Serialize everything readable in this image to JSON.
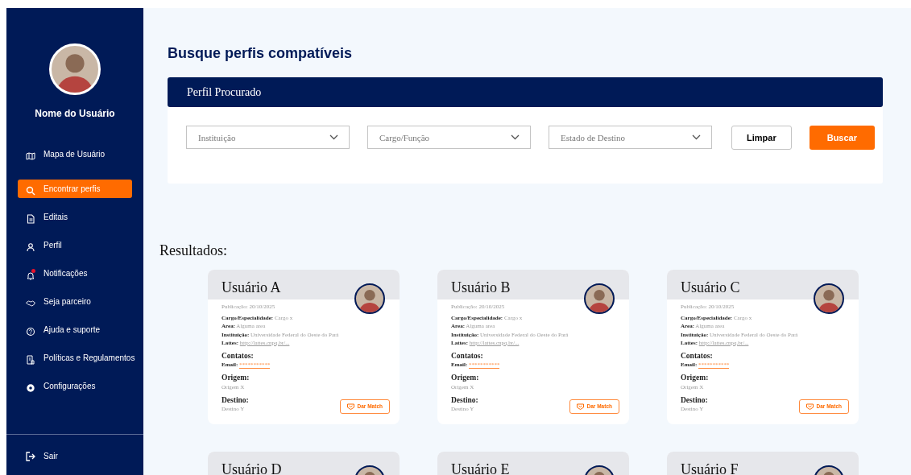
{
  "sidebar": {
    "user_name": "Nome do Usuário",
    "items": [
      {
        "label": "Mapa de Usuário",
        "selected": false,
        "alert": false
      },
      {
        "label": "Encontrar perfis",
        "selected": true,
        "alert": false
      },
      {
        "label": "Editais",
        "selected": false,
        "alert": false
      },
      {
        "label": "Perfil",
        "selected": false,
        "alert": false
      },
      {
        "label": "Notificações",
        "selected": false,
        "alert": true
      },
      {
        "label": "Seja parceiro",
        "selected": false,
        "alert": false
      },
      {
        "label": "Ajuda e suporte",
        "selected": false,
        "alert": false
      },
      {
        "label": "Políticas e Regulamentos",
        "selected": false,
        "alert": false
      },
      {
        "label": "Configurações",
        "selected": false,
        "alert": false
      }
    ],
    "logout": "Sair"
  },
  "page_title": "Busque perfis compatíveis",
  "search_panel": {
    "title": "Perfil Procurado",
    "filters": [
      {
        "placeholder": "Instituição"
      },
      {
        "placeholder": "Cargo/Função"
      },
      {
        "placeholder": "Estado de Destino"
      }
    ],
    "clear_button": "Limpar",
    "search_button": "Buscar"
  },
  "results_heading": "Resultados:",
  "cards": [
    {
      "name": "Usuário A",
      "publication": "Publicação: 20/10/2025",
      "fields": [
        {
          "label": "Cargo/Especialidade:",
          "value": "Cargo x",
          "kind": "text"
        },
        {
          "label": "Area:",
          "value": "Alguma area",
          "kind": "text"
        },
        {
          "label": "Instituição:",
          "value": "Universidade Federal do Oeste do Pará",
          "kind": "text"
        },
        {
          "label": "Lattes:",
          "value": "http://lattes.cnpq.br/...",
          "kind": "link"
        }
      ],
      "contacts_heading": "Contatos:",
      "email_label": "Email:",
      "email": "***********",
      "origin_heading": "Origem:",
      "origin": "Origem X",
      "destination_heading": "Destino:",
      "destination": "Destino Y",
      "button": "Dar Match"
    },
    {
      "name": "Usuário B",
      "publication": "Publicação: 20/10/2025",
      "fields": [
        {
          "label": "Cargo/Especialidade:",
          "value": "Cargo x",
          "kind": "text"
        },
        {
          "label": "Area:",
          "value": "Alguma area",
          "kind": "text"
        },
        {
          "label": "Instituição:",
          "value": "Universidade Federal do Oeste do Pará",
          "kind": "text"
        },
        {
          "label": "Lattes:",
          "value": "http://lattes.cnpq.br/...",
          "kind": "link"
        }
      ],
      "contacts_heading": "Contatos:",
      "email_label": "Email:",
      "email": "***********",
      "origin_heading": "Origem:",
      "origin": "Origem X",
      "destination_heading": "Destino:",
      "destination": "Destino Y",
      "button": "Dar Match"
    },
    {
      "name": "Usuário C",
      "publication": "Publicação: 20/10/2025",
      "fields": [
        {
          "label": "Cargo/Especialidade:",
          "value": "Cargo x",
          "kind": "text"
        },
        {
          "label": "Area:",
          "value": "Alguma area",
          "kind": "text"
        },
        {
          "label": "Instituição:",
          "value": "Universidade Federal do Oeste do Pará",
          "kind": "text"
        },
        {
          "label": "Lattes:",
          "value": "http://lattes.cnpq.br/...",
          "kind": "link"
        }
      ],
      "contacts_heading": "Contatos:",
      "email_label": "Email:",
      "email": "***********",
      "origin_heading": "Origem:",
      "origin": "Origem X",
      "destination_heading": "Destino:",
      "destination": "Destino Y",
      "button": "Dar Match"
    },
    {
      "name": "Usuário D"
    },
    {
      "name": "Usuário E"
    },
    {
      "name": "Usuário F"
    }
  ]
}
